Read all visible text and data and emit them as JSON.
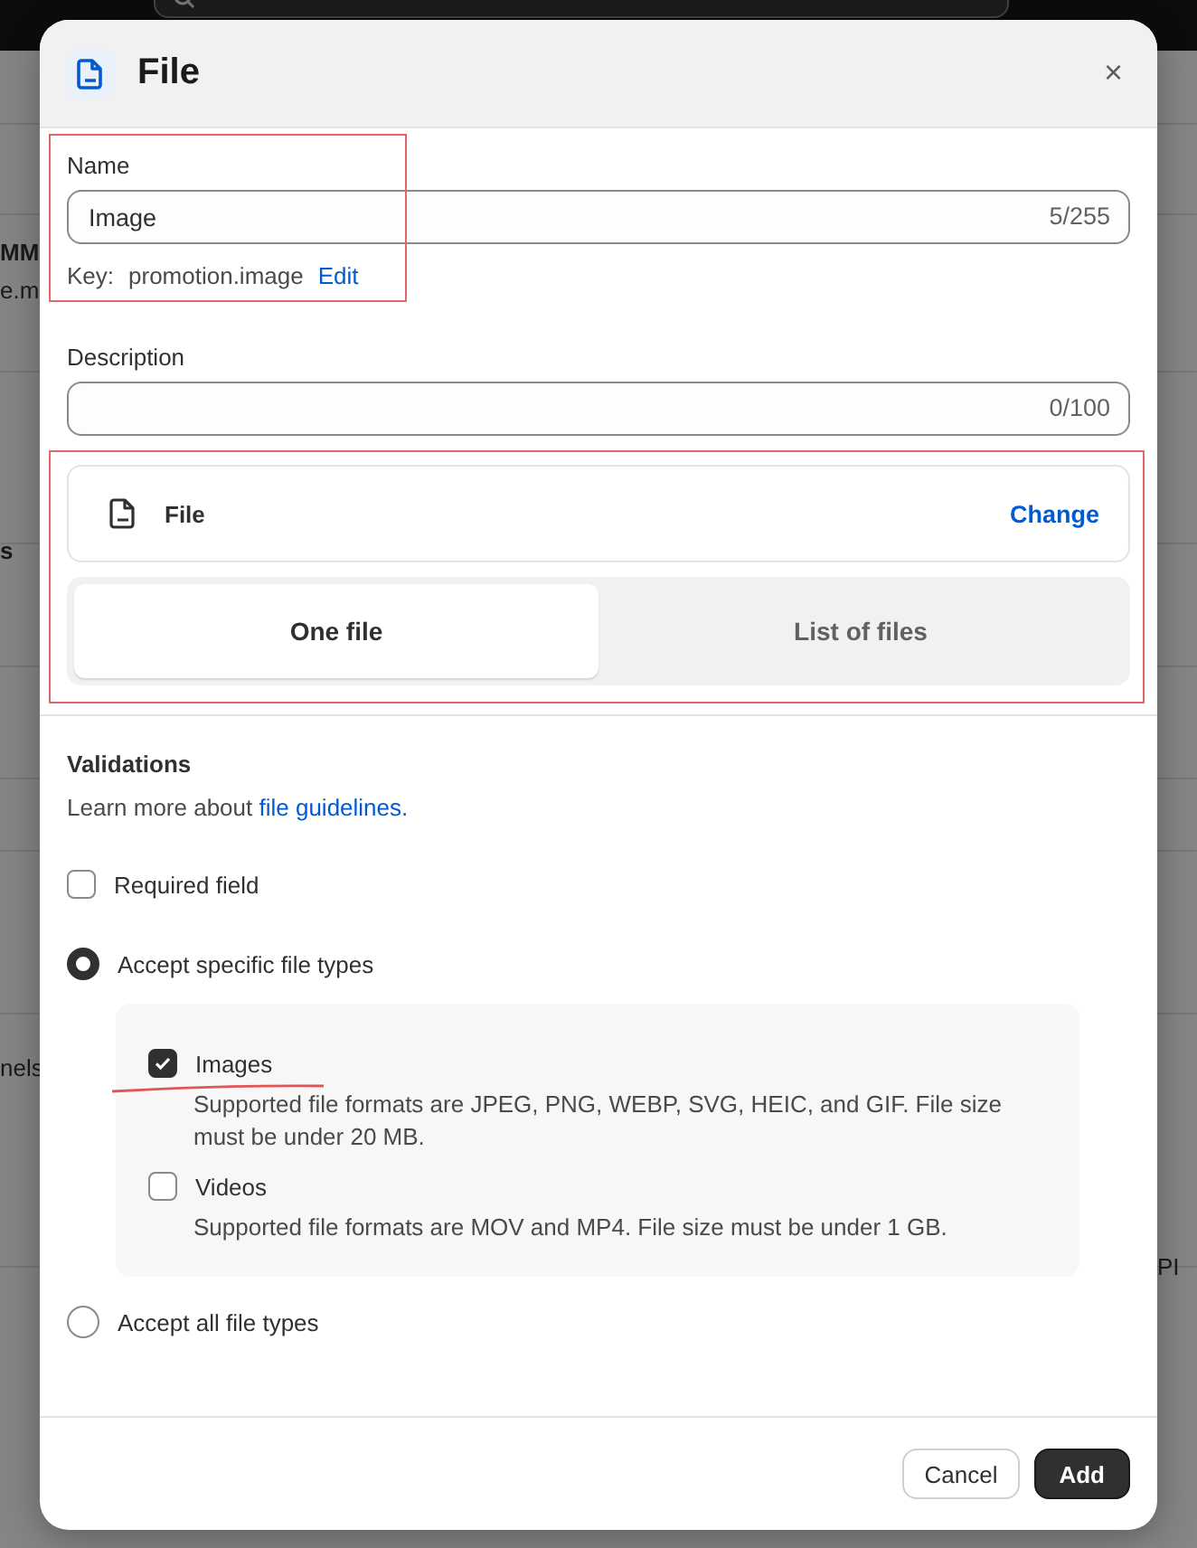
{
  "background": {
    "fragments": [
      "MM",
      "e.m",
      "s",
      "nels",
      "PI"
    ]
  },
  "modal": {
    "title": "File",
    "close": "×",
    "name_field": {
      "label": "Name",
      "value": "Image",
      "counter": "5/255",
      "key_label": "Key:",
      "key_value": "promotion.image",
      "edit_link": "Edit",
      "highlighted": true
    },
    "description_field": {
      "label": "Description",
      "counter": "0/100"
    },
    "type_section": {
      "highlighted": true,
      "type_name": "File",
      "change_link": "Change",
      "options": [
        {
          "label": "One file",
          "selected": true
        },
        {
          "label": "List of files",
          "selected": false
        }
      ]
    },
    "validations": {
      "heading": "Validations",
      "intro": "Learn more about",
      "link": "file guidelines.",
      "required": {
        "label": "Required field",
        "checked": false
      },
      "accept_options": [
        {
          "label": "Accept specific file types",
          "selected": true,
          "file_types": [
            {
              "label": "Images",
              "checked": true,
              "underlined": true,
              "description": "Supported file formats are JPEG, PNG, WEBP, SVG, HEIC, and GIF. File size must be under 20 MB."
            },
            {
              "label": "Videos",
              "checked": false,
              "underlined": false,
              "description": "Supported file formats are MOV and MP4. File size must be under 1 GB."
            }
          ]
        },
        {
          "label": "Accept all file types",
          "selected": false
        }
      ]
    },
    "buttons": [
      {
        "label": "Cancel",
        "kind": "secondary"
      },
      {
        "label": "Add",
        "kind": "primary"
      }
    ]
  }
}
